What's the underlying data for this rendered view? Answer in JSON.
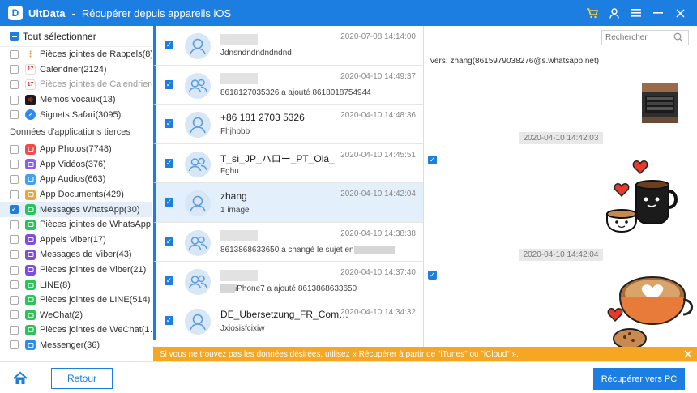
{
  "app": {
    "name": "UltData",
    "separator": "-",
    "subtitle": "Récupérer depuis appareils iOS",
    "logo_letter": "D"
  },
  "icons": {
    "cart": "cart-icon",
    "user": "user-icon",
    "menu": "menu-icon",
    "minimize": "minimize-icon",
    "close": "close-icon"
  },
  "sidebar": {
    "select_all": "Tout sélectionner",
    "items_top": [
      {
        "label": "Pièces jointes de Rappels(8)",
        "icon_color": "#ffffff",
        "icon": "dots"
      },
      {
        "label": "Calendrier(2124)",
        "icon_color": "#ffffff",
        "icon": "cal"
      },
      {
        "label": "Pièces jointes de Calendrier(…",
        "icon_color": "#ffffff",
        "icon": "cal",
        "dim": true
      },
      {
        "label": "Mémos vocaux(13)",
        "icon_color": "#1a1a1a",
        "icon": "wave"
      },
      {
        "label": "Signets Safari(3095)",
        "icon_color": "#2a8cf0",
        "icon": "safari"
      }
    ],
    "section_label": "Données d'applications tierces",
    "items_third": [
      {
        "label": "App Photos(7748)",
        "icon_color": "#f04b4b"
      },
      {
        "label": "App Vidéos(376)",
        "icon_color": "#8b5cf6"
      },
      {
        "label": "App Audios(663)",
        "icon_color": "#3fa0f5"
      },
      {
        "label": "App Documents(429)",
        "icon_color": "#f4a236"
      },
      {
        "label": "Messages WhatsApp(30)",
        "icon_color": "#25c35a",
        "checked": true,
        "selected": true
      },
      {
        "label": "Pièces jointes de WhatsApp…",
        "icon_color": "#25c35a"
      },
      {
        "label": "Appels Viber(17)",
        "icon_color": "#7b4fd6"
      },
      {
        "label": "Messages de Viber(43)",
        "icon_color": "#7b4fd6"
      },
      {
        "label": "Pièces jointes de Viber(21)",
        "icon_color": "#7b4fd6"
      },
      {
        "label": "LINE(8)",
        "icon_color": "#2fc25b"
      },
      {
        "label": "Pièces jointes de LINE(514)",
        "icon_color": "#2fc25b"
      },
      {
        "label": "WeChat(2)",
        "icon_color": "#2fc25b"
      },
      {
        "label": "Pièces jointes de WeChat(1…",
        "icon_color": "#2fc25b"
      },
      {
        "label": "Messenger(36)",
        "icon_color": "#2d8cf0"
      }
    ]
  },
  "messages": [
    {
      "name": "",
      "time": "2020-07-08 14:14:00",
      "msg": "Jdnsndndndndndnd",
      "avatar": "single"
    },
    {
      "name": "",
      "time": "2020-04-10 14:49:37",
      "msg": "8618127035326 a ajouté 8618018754944",
      "avatar": "group"
    },
    {
      "name": "+86 181 2703 5326",
      "time": "2020-04-10 14:48:36",
      "msg": "Fhjhbbb",
      "avatar": "single"
    },
    {
      "name": "T_sì_JP_ハロー_PT_Olá_",
      "time": "2020-04-10 14:45:51",
      "msg": "Fghu",
      "avatar": "group"
    },
    {
      "name": "zhang",
      "time": "2020-04-10 14:42:04",
      "msg": "1 image",
      "avatar": "single",
      "selected": true
    },
    {
      "name": "",
      "time": "2020-04-10 14:38:38",
      "msg": "8613868633650 a changé le sujet en",
      "avatar": "group"
    },
    {
      "name": "",
      "time": "2020-04-10 14:37:40",
      "msg": "iPhone7 a ajouté 8613868633650",
      "avatar": "group"
    },
    {
      "name": "DE_Übersetzung_FR_Com…",
      "time": "2020-04-10 14:34:32",
      "msg": "Jxiosisfcixiw",
      "avatar": "single"
    }
  ],
  "conversation": {
    "from": "vers: zhang(8615979038276@s.whatsapp.net)",
    "stamps": [
      "2020-04-10 14:42:03",
      "2020-04-10 14:42:04"
    ]
  },
  "search": {
    "placeholder": "Rechercher"
  },
  "notice": {
    "text": "Si vous ne trouvez pas les données désirées, utilisez « Récupérer à partir de \"iTunes\" ou \"iCloud\" »."
  },
  "bottom": {
    "back_label": "Retour",
    "recover_label": "Récupérer vers PC"
  },
  "colors": {
    "accent": "#1c7ee0",
    "notice": "#f5a623"
  }
}
